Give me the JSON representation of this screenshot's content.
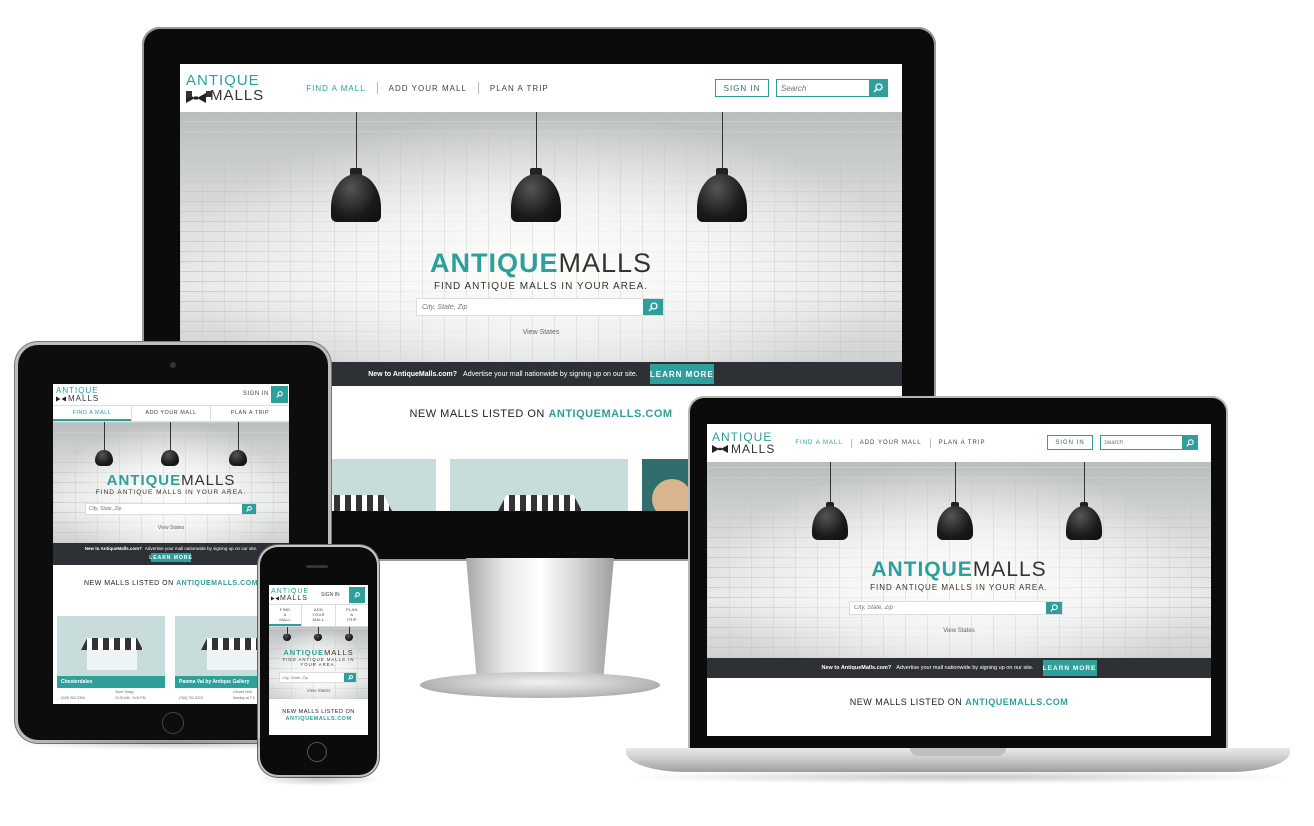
{
  "site": {
    "logo_line1": "ANTIQUE",
    "logo_line2": "MALLS",
    "nav": [
      "FIND A MALL",
      "ADD YOUR MALL",
      "PLAN A TRIP"
    ],
    "phone_nav": [
      "FIND\nA\nMALL",
      "ADD\nYOUR\nMALL",
      "PLAN\nA\nTRIP"
    ],
    "sign_in": "SIGN IN",
    "search_placeholder": "Search",
    "hero_title_a": "ANTIQUE",
    "hero_title_b": "MALLS",
    "hero_subtitle": "FIND ANTIQUE MALLS IN YOUR AREA.",
    "hero_search_placeholder": "City, State, Zip",
    "view_states": "View States",
    "promo_lead": "New to AntiqueMalls.com?",
    "promo_text": "Advertise your mall nationwide by signing up on our site.",
    "learn_more": "LEARN MORE",
    "new_malls_prefix": "NEW MALLS LISTED ON",
    "new_malls_site": "ANTIQUEMALLS.COM",
    "cards": [
      {
        "name": "Chesterdales",
        "phone": "(239) 262-3354",
        "hours_label": "Store Today",
        "hours": "11:00 AM - 6:00 PM"
      },
      {
        "name": "Paoma Val by Antique Gallery",
        "phone": "(760) 722-5212",
        "hours_label": "Closed Until",
        "hours": "Sunday at 7:3"
      }
    ]
  },
  "colors": {
    "accent": "#2f9f9c",
    "promo_bg": "#2d3035",
    "text": "#333333"
  },
  "icons": [
    "bowtie-icon",
    "search-icon"
  ]
}
